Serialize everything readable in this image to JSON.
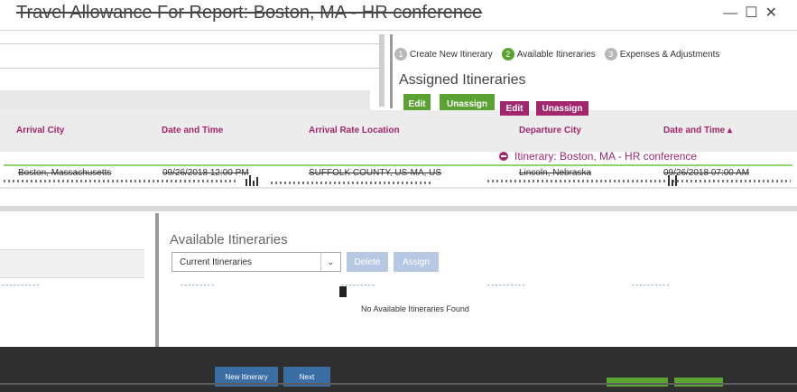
{
  "window": {
    "title": "Travel Allowance For Report: Boston, MA - HR conference",
    "controls": "—☐✕"
  },
  "steps": [
    {
      "num": "1",
      "label": "Create New Itinerary",
      "state": "done"
    },
    {
      "num": "2",
      "label": "Available Itineraries",
      "state": "active"
    },
    {
      "num": "3",
      "label": "Expenses & Adjustments",
      "state": "pending"
    }
  ],
  "assigned": {
    "title": "Assigned Itineraries",
    "edit_label": "Edit",
    "unassign_label": "Unassign",
    "edit_label_2": "Edit",
    "unassign_label_2": "Unassign"
  },
  "columns": {
    "arrival_city": "Arrival City",
    "date_time": "Date and Time",
    "arrival_rate_location": "Arrival Rate Location",
    "departure_city": "Departure City",
    "date_time_2": "Date and Time ▴"
  },
  "itinerary": {
    "label": "Itinerary: Boston, MA - HR conference"
  },
  "rows": [
    {
      "arrival_city": "Boston, Massachusetts",
      "date_time": "09/26/2018 12:00 PM",
      "rate_location": "SUFFOLK COUNTY, US-MA, US",
      "departure_city": "Lincoln, Nebraska",
      "departure_date": "09/26/2018 07:00 AM"
    }
  ],
  "available": {
    "title": "Available Itineraries",
    "select_value": "Current Itineraries",
    "delete_label": "Delete",
    "assign_label": "Assign",
    "empty_message": "No Available Itineraries Found"
  },
  "footer": {
    "new_itinerary_label": "New Itinerary",
    "next_label": "Next"
  },
  "colors": {
    "accent_green": "#5aa332",
    "accent_purple": "#a3276d",
    "accent_blue": "#3a6ea5"
  }
}
